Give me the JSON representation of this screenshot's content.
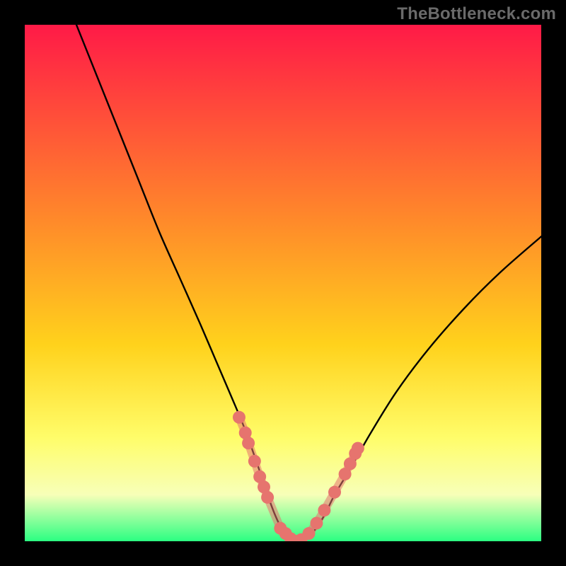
{
  "watermark": "TheBottleneck.com",
  "colors": {
    "frame": "#000000",
    "gradient_top": "#ff1a47",
    "gradient_mid1": "#ff8a2a",
    "gradient_mid2": "#ffd21c",
    "gradient_mid3": "#fffd6a",
    "gradient_light": "#f7ffb8",
    "gradient_green": "#2bff82",
    "curve": "#000000",
    "marker": "#e6746e"
  },
  "chart_data": {
    "type": "line",
    "title": "",
    "xlabel": "",
    "ylabel": "",
    "xlim": [
      0,
      100
    ],
    "ylim": [
      0,
      100
    ],
    "series": [
      {
        "name": "curve-left",
        "x": [
          10,
          14,
          18,
          22,
          26,
          30,
          34,
          37,
          40,
          42.5,
          45,
          47,
          48.5,
          50,
          51.5,
          52.5
        ],
        "y": [
          100,
          90,
          80,
          70,
          60,
          51,
          42,
          35,
          28,
          22,
          15,
          9,
          5,
          2,
          0.5,
          0
        ]
      },
      {
        "name": "curve-right",
        "x": [
          52.5,
          54,
          56,
          58,
          60,
          63,
          67,
          72,
          78,
          85,
          92,
          100
        ],
        "y": [
          0,
          0.5,
          2,
          5,
          9,
          14,
          21,
          29,
          37,
          45,
          52,
          59
        ]
      }
    ],
    "markers": {
      "name": "highlight-dots",
      "points": [
        {
          "x": 41.5,
          "y": 24
        },
        {
          "x": 42.7,
          "y": 21
        },
        {
          "x": 43.3,
          "y": 19
        },
        {
          "x": 44.5,
          "y": 15.5
        },
        {
          "x": 45.5,
          "y": 12.5
        },
        {
          "x": 46.3,
          "y": 10.5
        },
        {
          "x": 47.0,
          "y": 8.5
        },
        {
          "x": 49.5,
          "y": 2.5
        },
        {
          "x": 50.5,
          "y": 1.5
        },
        {
          "x": 51.5,
          "y": 0.5
        },
        {
          "x": 52.5,
          "y": 0
        },
        {
          "x": 53.5,
          "y": 0.3
        },
        {
          "x": 55.0,
          "y": 1.5
        },
        {
          "x": 56.5,
          "y": 3.5
        },
        {
          "x": 58.0,
          "y": 6.0
        },
        {
          "x": 60.0,
          "y": 9.5
        },
        {
          "x": 62.0,
          "y": 13
        },
        {
          "x": 63.0,
          "y": 15
        },
        {
          "x": 64.0,
          "y": 17
        },
        {
          "x": 64.5,
          "y": 18
        }
      ]
    }
  }
}
